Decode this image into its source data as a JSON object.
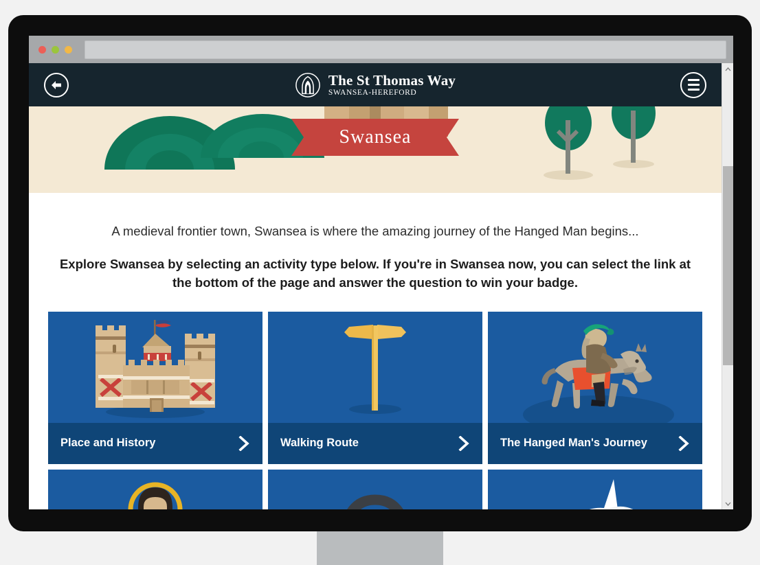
{
  "browser": {
    "url_value": "",
    "url_placeholder": "",
    "traffic_lights": [
      "close",
      "minimize",
      "maximize"
    ],
    "colors": {
      "close": "#ec5f57",
      "minimize": "#9bc53d",
      "maximize": "#f2b846"
    }
  },
  "site_header": {
    "back_label": "Back",
    "brand_title": "The St Thomas Way",
    "brand_subtitle": "Swansea-Hereford",
    "menu_label": "Menu",
    "background": "#16252e"
  },
  "hero": {
    "place_name": "Swansea",
    "ribbon_color": "#c5443e",
    "background": "#f4e9d4",
    "hill_color": "#10785c",
    "tree_color": "#12795d"
  },
  "content": {
    "intro": "A medieval frontier town, Swansea is where the amazing journey of the Hanged Man begins...",
    "instruction": "Explore Swansea by selecting an activity type below. If you're in Swansea now, you can select the link at the bottom of the page and answer the question to win your badge."
  },
  "cards": {
    "accent": "#1b5ba0",
    "footer": "#0f4577",
    "row1": [
      {
        "label": "Place and History",
        "icon": "castle-icon"
      },
      {
        "label": "Walking Route",
        "icon": "signpost-icon"
      },
      {
        "label": "The Hanged Man's Journey",
        "icon": "horse-rider-icon"
      }
    ],
    "row2": [
      {
        "label": "",
        "icon": "saint-icon"
      },
      {
        "label": "",
        "icon": "headphones-icon"
      },
      {
        "label": "",
        "icon": "dove-icon"
      }
    ]
  },
  "scrollbar": {
    "up_label": "Scroll up",
    "down_label": "Scroll down",
    "thumb_label": "Scroll thumb"
  }
}
